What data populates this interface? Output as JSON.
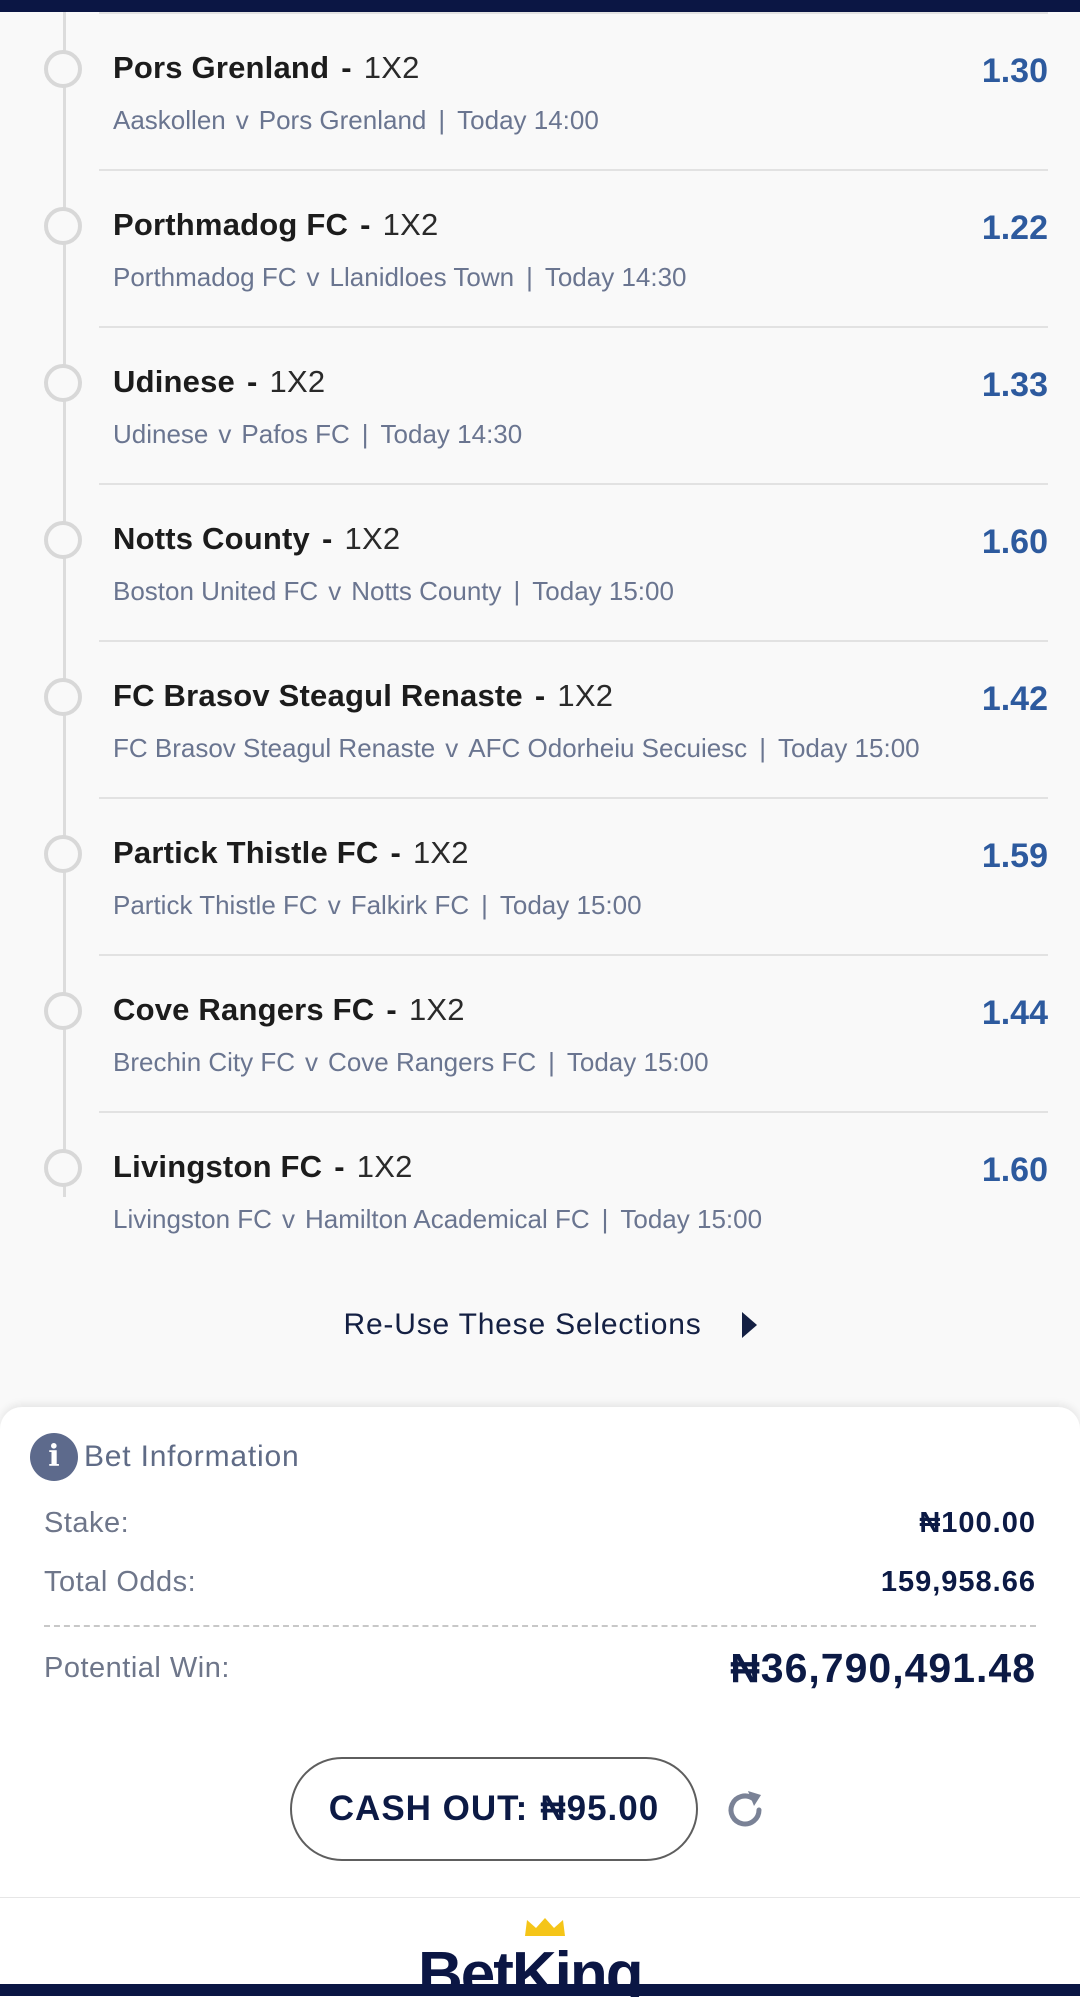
{
  "selections": [
    {
      "team": "Pors Grenland",
      "market": "1X2",
      "home": "Aaskollen",
      "away": "Pors Grenland",
      "time": "Today 14:00",
      "odds": "1.30"
    },
    {
      "team": "Porthmadog FC",
      "market": "1X2",
      "home": "Porthmadog FC",
      "away": "Llanidloes Town",
      "time": "Today 14:30",
      "odds": "1.22"
    },
    {
      "team": "Udinese",
      "market": "1X2",
      "home": "Udinese",
      "away": "Pafos FC",
      "time": "Today 14:30",
      "odds": "1.33"
    },
    {
      "team": "Notts County",
      "market": "1X2",
      "home": "Boston United FC",
      "away": "Notts County",
      "time": "Today 15:00",
      "odds": "1.60"
    },
    {
      "team": "FC Brasov Steagul Renaste",
      "market": "1X2",
      "home": "FC Brasov Steagul Renaste",
      "away": "AFC Odorheiu Secuiesc",
      "time": "Today 15:00",
      "odds": "1.42"
    },
    {
      "team": "Partick Thistle FC",
      "market": "1X2",
      "home": "Partick Thistle FC",
      "away": "Falkirk FC",
      "time": "Today 15:00",
      "odds": "1.59"
    },
    {
      "team": "Cove Rangers FC",
      "market": "1X2",
      "home": "Brechin City FC",
      "away": "Cove Rangers FC",
      "time": "Today 15:00",
      "odds": "1.44"
    },
    {
      "team": "Livingston FC",
      "market": "1X2",
      "home": "Livingston FC",
      "away": "Hamilton Academical FC",
      "time": "Today 15:00",
      "odds": "1.60"
    }
  ],
  "separators": {
    "dash": "-",
    "versus": "v",
    "pipe": "|"
  },
  "reuse": {
    "label": "Re-Use These Selections"
  },
  "bet_info": {
    "title": "Bet Information",
    "info_glyph": "i",
    "stake_label": "Stake:",
    "stake_value": "₦100.00",
    "total_odds_label": "Total Odds:",
    "total_odds_value": "159,958.66",
    "potential_win_label": "Potential Win:",
    "potential_win_value": "₦36,790,491.48"
  },
  "cashout": {
    "label": "CASH OUT:",
    "amount": "₦95.00"
  },
  "footer": {
    "logo_text": "BetKing"
  },
  "colors": {
    "navy": "#0b1644",
    "odds_blue": "#2d5a9e",
    "crown": "#f5c518"
  }
}
